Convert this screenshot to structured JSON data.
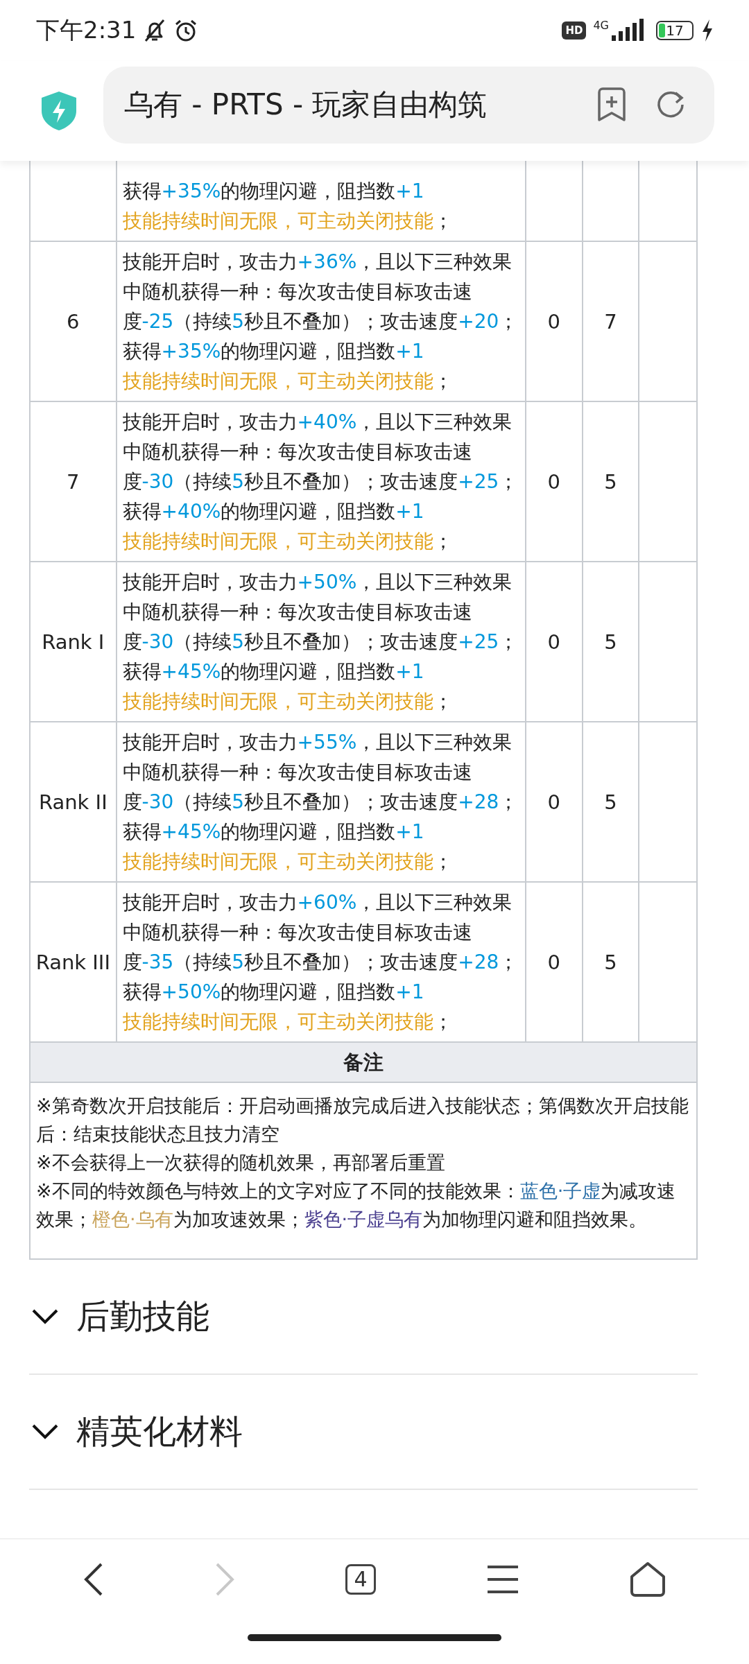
{
  "status_bar": {
    "time": "下午2:31",
    "hd": "HD",
    "network": "4G",
    "battery": "17"
  },
  "address_bar": {
    "title": "乌有 - PRTS - 玩家自由构筑"
  },
  "skill_table": {
    "rows": [
      {
        "level": "",
        "col3": "",
        "col4": "",
        "description": [
          [
            {
              "kind": "plain",
              "text": "获得"
            },
            {
              "kind": "value",
              "text": "+35%"
            },
            {
              "kind": "plain",
              "text": "的物理闪避，阻挡数"
            },
            {
              "kind": "value",
              "text": "+1"
            }
          ],
          [
            {
              "kind": "note",
              "text": "技能持续时间无限，可主动关闭技能"
            },
            {
              "kind": "plain",
              "text": "；"
            }
          ]
        ]
      },
      {
        "level": "6",
        "col3": "0",
        "col4": "7",
        "description": [
          [
            {
              "kind": "plain",
              "text": "技能开启时，攻击力"
            },
            {
              "kind": "value",
              "text": "+36%"
            },
            {
              "kind": "plain",
              "text": "，且以下三种效果"
            }
          ],
          [
            {
              "kind": "plain",
              "text": "中随机获得一种：每次攻击使目标攻击速"
            }
          ],
          [
            {
              "kind": "plain",
              "text": "度"
            },
            {
              "kind": "value",
              "text": "-25"
            },
            {
              "kind": "plain",
              "text": "（持续"
            },
            {
              "kind": "value",
              "text": "5"
            },
            {
              "kind": "plain",
              "text": "秒且不叠加）；攻击速度"
            },
            {
              "kind": "value",
              "text": "+20"
            },
            {
              "kind": "plain",
              "text": "；"
            }
          ],
          [
            {
              "kind": "plain",
              "text": "获得"
            },
            {
              "kind": "value",
              "text": "+35%"
            },
            {
              "kind": "plain",
              "text": "的物理闪避，阻挡数"
            },
            {
              "kind": "value",
              "text": "+1"
            }
          ],
          [
            {
              "kind": "note",
              "text": "技能持续时间无限，可主动关闭技能"
            },
            {
              "kind": "plain",
              "text": "；"
            }
          ]
        ]
      },
      {
        "level": "7",
        "col3": "0",
        "col4": "5",
        "description": [
          [
            {
              "kind": "plain",
              "text": "技能开启时，攻击力"
            },
            {
              "kind": "value",
              "text": "+40%"
            },
            {
              "kind": "plain",
              "text": "，且以下三种效果"
            }
          ],
          [
            {
              "kind": "plain",
              "text": "中随机获得一种：每次攻击使目标攻击速"
            }
          ],
          [
            {
              "kind": "plain",
              "text": "度"
            },
            {
              "kind": "value",
              "text": "-30"
            },
            {
              "kind": "plain",
              "text": "（持续"
            },
            {
              "kind": "value",
              "text": "5"
            },
            {
              "kind": "plain",
              "text": "秒且不叠加）；攻击速度"
            },
            {
              "kind": "value",
              "text": "+25"
            },
            {
              "kind": "plain",
              "text": "；"
            }
          ],
          [
            {
              "kind": "plain",
              "text": "获得"
            },
            {
              "kind": "value",
              "text": "+40%"
            },
            {
              "kind": "plain",
              "text": "的物理闪避，阻挡数"
            },
            {
              "kind": "value",
              "text": "+1"
            }
          ],
          [
            {
              "kind": "note",
              "text": "技能持续时间无限，可主动关闭技能"
            },
            {
              "kind": "plain",
              "text": "；"
            }
          ]
        ]
      },
      {
        "level": "Rank I",
        "col3": "0",
        "col4": "5",
        "description": [
          [
            {
              "kind": "plain",
              "text": "技能开启时，攻击力"
            },
            {
              "kind": "value",
              "text": "+50%"
            },
            {
              "kind": "plain",
              "text": "，且以下三种效果"
            }
          ],
          [
            {
              "kind": "plain",
              "text": "中随机获得一种：每次攻击使目标攻击速"
            }
          ],
          [
            {
              "kind": "plain",
              "text": "度"
            },
            {
              "kind": "value",
              "text": "-30"
            },
            {
              "kind": "plain",
              "text": "（持续"
            },
            {
              "kind": "value",
              "text": "5"
            },
            {
              "kind": "plain",
              "text": "秒且不叠加）；攻击速度"
            },
            {
              "kind": "value",
              "text": "+25"
            },
            {
              "kind": "plain",
              "text": "；"
            }
          ],
          [
            {
              "kind": "plain",
              "text": "获得"
            },
            {
              "kind": "value",
              "text": "+45%"
            },
            {
              "kind": "plain",
              "text": "的物理闪避，阻挡数"
            },
            {
              "kind": "value",
              "text": "+1"
            }
          ],
          [
            {
              "kind": "note",
              "text": "技能持续时间无限，可主动关闭技能"
            },
            {
              "kind": "plain",
              "text": "；"
            }
          ]
        ]
      },
      {
        "level": "Rank II",
        "col3": "0",
        "col4": "5",
        "description": [
          [
            {
              "kind": "plain",
              "text": "技能开启时，攻击力"
            },
            {
              "kind": "value",
              "text": "+55%"
            },
            {
              "kind": "plain",
              "text": "，且以下三种效果"
            }
          ],
          [
            {
              "kind": "plain",
              "text": "中随机获得一种：每次攻击使目标攻击速"
            }
          ],
          [
            {
              "kind": "plain",
              "text": "度"
            },
            {
              "kind": "value",
              "text": "-30"
            },
            {
              "kind": "plain",
              "text": "（持续"
            },
            {
              "kind": "value",
              "text": "5"
            },
            {
              "kind": "plain",
              "text": "秒且不叠加）；攻击速度"
            },
            {
              "kind": "value",
              "text": "+28"
            },
            {
              "kind": "plain",
              "text": "；"
            }
          ],
          [
            {
              "kind": "plain",
              "text": "获得"
            },
            {
              "kind": "value",
              "text": "+45%"
            },
            {
              "kind": "plain",
              "text": "的物理闪避，阻挡数"
            },
            {
              "kind": "value",
              "text": "+1"
            }
          ],
          [
            {
              "kind": "note",
              "text": "技能持续时间无限，可主动关闭技能"
            },
            {
              "kind": "plain",
              "text": "；"
            }
          ]
        ]
      },
      {
        "level": "Rank III",
        "col3": "0",
        "col4": "5",
        "description": [
          [
            {
              "kind": "plain",
              "text": "技能开启时，攻击力"
            },
            {
              "kind": "value",
              "text": "+60%"
            },
            {
              "kind": "plain",
              "text": "，且以下三种效果"
            }
          ],
          [
            {
              "kind": "plain",
              "text": "中随机获得一种：每次攻击使目标攻击速"
            }
          ],
          [
            {
              "kind": "plain",
              "text": "度"
            },
            {
              "kind": "value",
              "text": "-35"
            },
            {
              "kind": "plain",
              "text": "（持续"
            },
            {
              "kind": "value",
              "text": "5"
            },
            {
              "kind": "plain",
              "text": "秒且不叠加）；攻击速度"
            },
            {
              "kind": "value",
              "text": "+28"
            },
            {
              "kind": "plain",
              "text": "；"
            }
          ],
          [
            {
              "kind": "plain",
              "text": "获得"
            },
            {
              "kind": "value",
              "text": "+50%"
            },
            {
              "kind": "plain",
              "text": "的物理闪避，阻挡数"
            },
            {
              "kind": "value",
              "text": "+1"
            }
          ],
          [
            {
              "kind": "note",
              "text": "技能持续时间无限，可主动关闭技能"
            },
            {
              "kind": "plain",
              "text": "；"
            }
          ]
        ]
      }
    ],
    "remarks": {
      "title": "备注",
      "paragraphs": [
        [
          {
            "kind": "plain",
            "text": "※第奇数次开启技能后：开启动画播放完成后进入技能状态；第偶数次开启技能后：结束技能状态且技力清空"
          }
        ],
        [
          {
            "kind": "plain",
            "text": "※不会获得上一次获得的随机效果，再部署后重置"
          }
        ],
        [
          {
            "kind": "plain",
            "text": "※不同的特效颜色与特效上的文字对应了不同的技能效果："
          },
          {
            "kind": "term",
            "text": "蓝色·子虚",
            "color": "#2b6fa8"
          },
          {
            "kind": "plain",
            "text": "为减攻速效果；"
          },
          {
            "kind": "term",
            "text": "橙色·乌有",
            "color": "#c9a35a"
          },
          {
            "kind": "plain",
            "text": "为加攻速效果；"
          },
          {
            "kind": "term",
            "text": "紫色·子虚乌有",
            "color": "#4a3f8f"
          },
          {
            "kind": "plain",
            "text": "为加物理闪避和阻挡效果。"
          }
        ]
      ]
    }
  },
  "sections": [
    {
      "title": "后勤技能"
    },
    {
      "title": "精英化材料"
    }
  ],
  "nav": {
    "forward": {
      "disabled": true
    },
    "tab_count": "4"
  }
}
